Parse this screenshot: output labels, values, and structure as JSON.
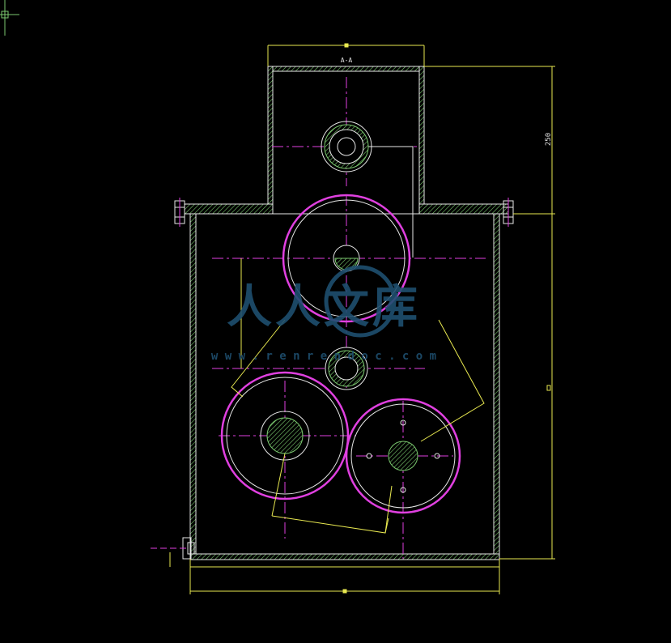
{
  "drawing": {
    "section_label": "A-A",
    "dimension_height": "250",
    "colors": {
      "background": "#000000",
      "outline": "#e8e8e8",
      "hatch": "#7bc96f",
      "gear": "#e040e0",
      "centerline": "#e040e0",
      "dimension": "#e8e850"
    }
  },
  "watermark": {
    "text": "人人文库",
    "url": "w w w . r e n r e n d o c . c o m",
    "color": "#1f4f6f"
  }
}
